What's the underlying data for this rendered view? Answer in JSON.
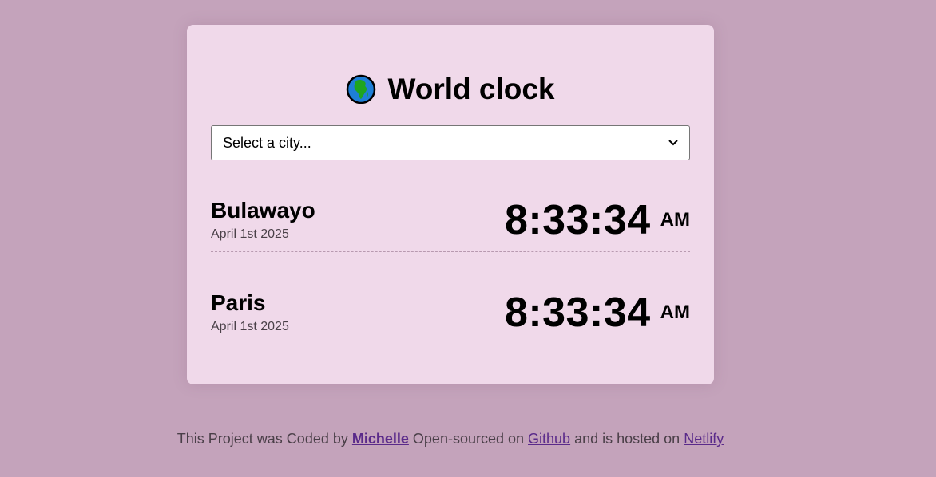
{
  "header": {
    "title": "World clock",
    "globe_icon": "globe-africa-icon"
  },
  "city_select": {
    "selected_label": "Select a city..."
  },
  "cities": [
    {
      "name": "Bulawayo",
      "date": "April 1st 2025",
      "time": "8:33:34",
      "ampm": "AM"
    },
    {
      "name": "Paris",
      "date": "April 1st 2025",
      "time": "8:33:34",
      "ampm": "AM"
    }
  ],
  "footer": {
    "prefix": "This Project was Coded by",
    "author": "Michelle",
    "middle": "Open-sourced on",
    "github": "Github",
    "middle2": "and is hosted on",
    "netlify": "Netlify"
  },
  "colors": {
    "background": "#c4a3bb",
    "card": "#f0d9ea",
    "link": "#5a2a8a"
  }
}
